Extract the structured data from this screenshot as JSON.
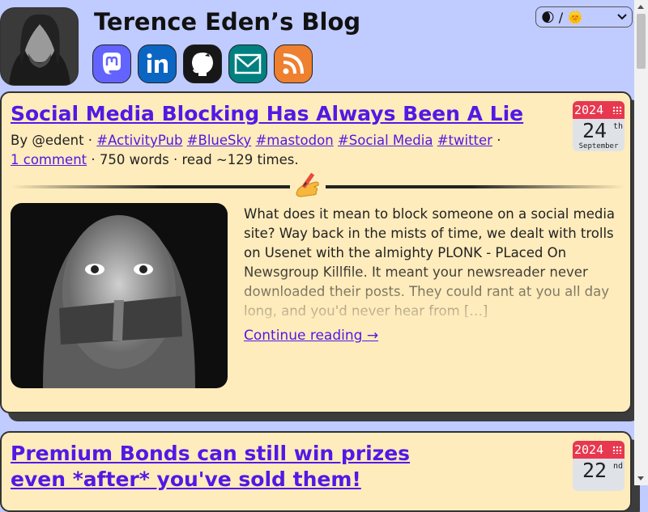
{
  "site": {
    "title": "Terence Eden’s Blog"
  },
  "social": [
    {
      "name": "mastodon-icon",
      "color": "#6364ff"
    },
    {
      "name": "linkedin-icon",
      "color": "#0a66c2"
    },
    {
      "name": "github-icon",
      "color": "#181717"
    },
    {
      "name": "email-icon",
      "color": "#008080"
    },
    {
      "name": "rss-icon",
      "color": "#ee802f"
    }
  ],
  "theme_toggle": {
    "label": "🌒 / 🌞"
  },
  "posts": [
    {
      "title": "Social Media Blocking Has Always Been A Lie",
      "by": "By @edent",
      "tags": [
        "#ActivityPub",
        "#BlueSky",
        "#mastodon",
        "#Social Media",
        "#twitter"
      ],
      "comments": "1 comment",
      "stats": "· 750 words · read ~129 times.",
      "date": {
        "year": "2024",
        "day": "24",
        "suffix": "th",
        "month": "September"
      },
      "excerpt": "What does it mean to block someone on a social media site? Way back in the mists of time, we dealt with trolls on Usenet with the almighty PLONK - PLaced On Newsgroup Killfile. It meant your newsreader never downloaded their posts. They could rant at you all day long, and you'd never hear from […]",
      "continue": "Continue reading →"
    },
    {
      "title": "Premium Bonds can still win prizes even *after* you've sold them!",
      "date": {
        "year": "2024",
        "day": "22",
        "suffix": "nd"
      }
    }
  ],
  "colors": {
    "background": "#c0cbff",
    "card": "#ffecbc",
    "link": "#5119e6",
    "calendar": "#e8384f"
  }
}
